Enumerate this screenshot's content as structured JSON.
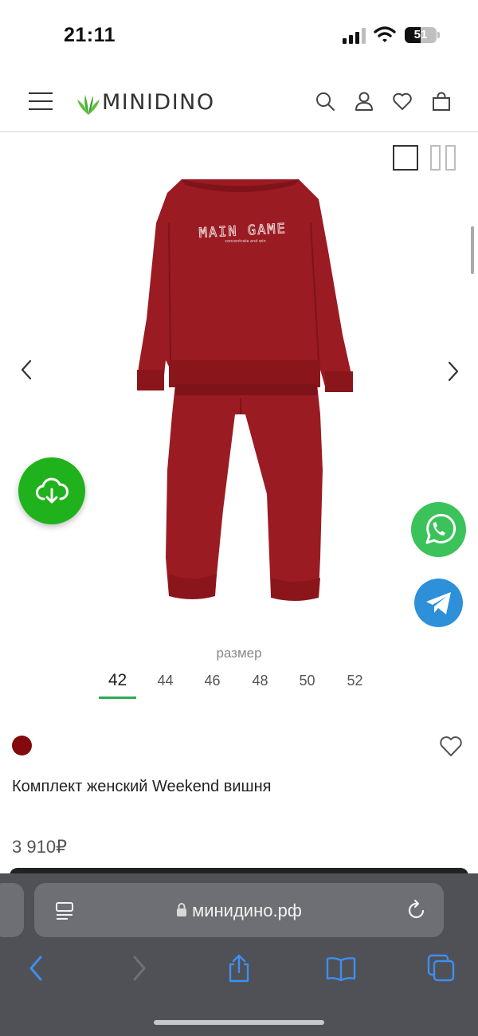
{
  "status": {
    "time": "21:11",
    "battery": "51",
    "battery_level": 0.51
  },
  "header": {
    "logo_text": "MINIDINO"
  },
  "product": {
    "print_title": "MAIN GAME",
    "print_subtitle": "concentrate and win",
    "color_hex": "#820a0e",
    "title": "Комплект женский Weekend вишня",
    "price": "3 910₽"
  },
  "sizes": {
    "label": "размер",
    "options": [
      "42",
      "44",
      "46",
      "48",
      "50",
      "52"
    ],
    "selected": "42"
  },
  "browser": {
    "url": "минидино.рф"
  },
  "colors": {
    "accent": "#2bab54",
    "fab_green": "#20b21c",
    "whatsapp": "#3cc25a",
    "telegram": "#2e90d9",
    "ios_blue": "#3d8ff0"
  }
}
